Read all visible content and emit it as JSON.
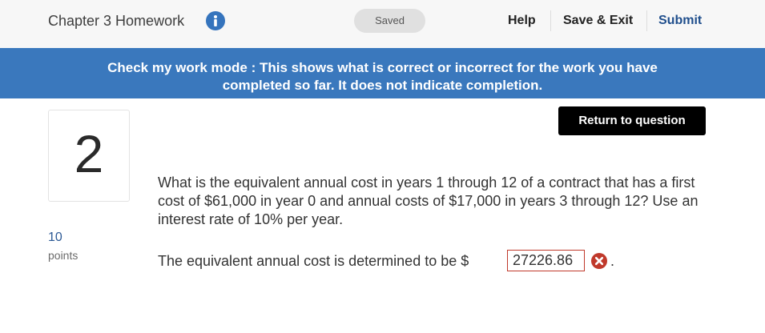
{
  "header": {
    "title": "Chapter 3 Homework",
    "info_icon": "info-icon",
    "saved_label": "Saved",
    "help_label": "Help",
    "save_exit_label": "Save & Exit",
    "submit_label": "Submit"
  },
  "banner": {
    "line1": "Check my work mode : This shows what is correct or incorrect for the work you have",
    "line2": "completed so far. It does not indicate completion."
  },
  "question": {
    "number": "2",
    "points_value": "10",
    "points_label": "points",
    "return_label": "Return to question",
    "text": "What is the equivalent annual cost in years 1 through 12 of a contract that has a first cost of $61,000 in year 0 and annual costs of $17,000 in years 3 through 12? Use an interest rate of 10% per year.",
    "answer_prefix": "The equivalent annual cost is determined to be $",
    "answer_value": "27226.86",
    "answer_suffix": ".",
    "answer_status_icon": "incorrect-x-icon"
  },
  "colors": {
    "banner": "#3a78bd",
    "info_icon": "#3574bd",
    "incorrect": "#c0392b",
    "submit": "#1f4e8c"
  }
}
